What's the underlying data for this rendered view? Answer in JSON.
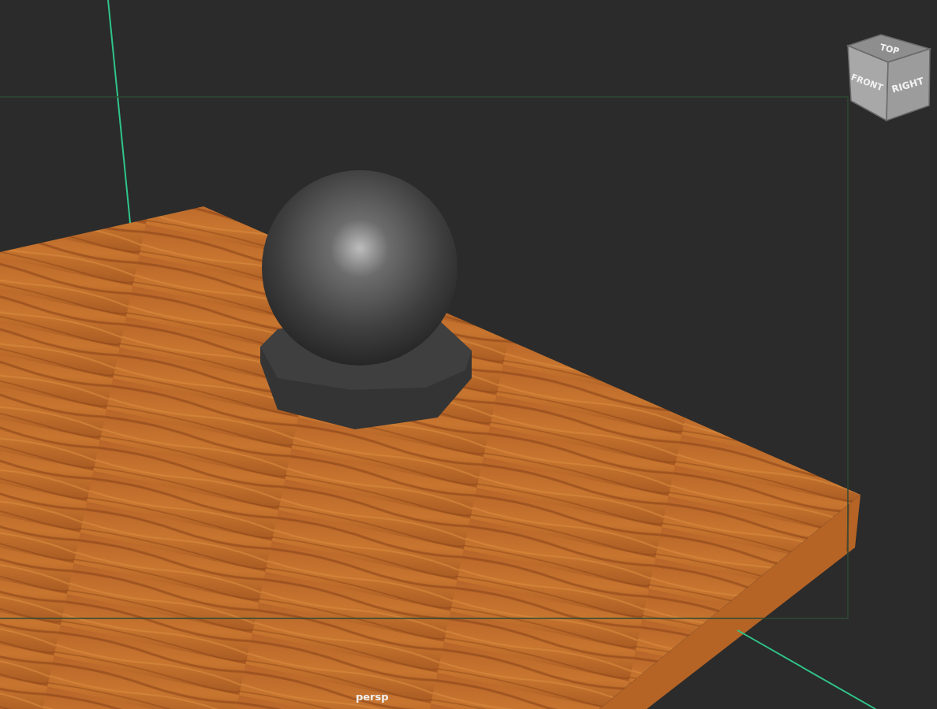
{
  "viewport": {
    "camera_label": "persp"
  },
  "view_cube": {
    "faces": [
      {
        "kind": "top",
        "label": "TOP"
      },
      {
        "kind": "front",
        "label": "FRONT"
      },
      {
        "kind": "right",
        "label": "RIGHT"
      }
    ]
  }
}
